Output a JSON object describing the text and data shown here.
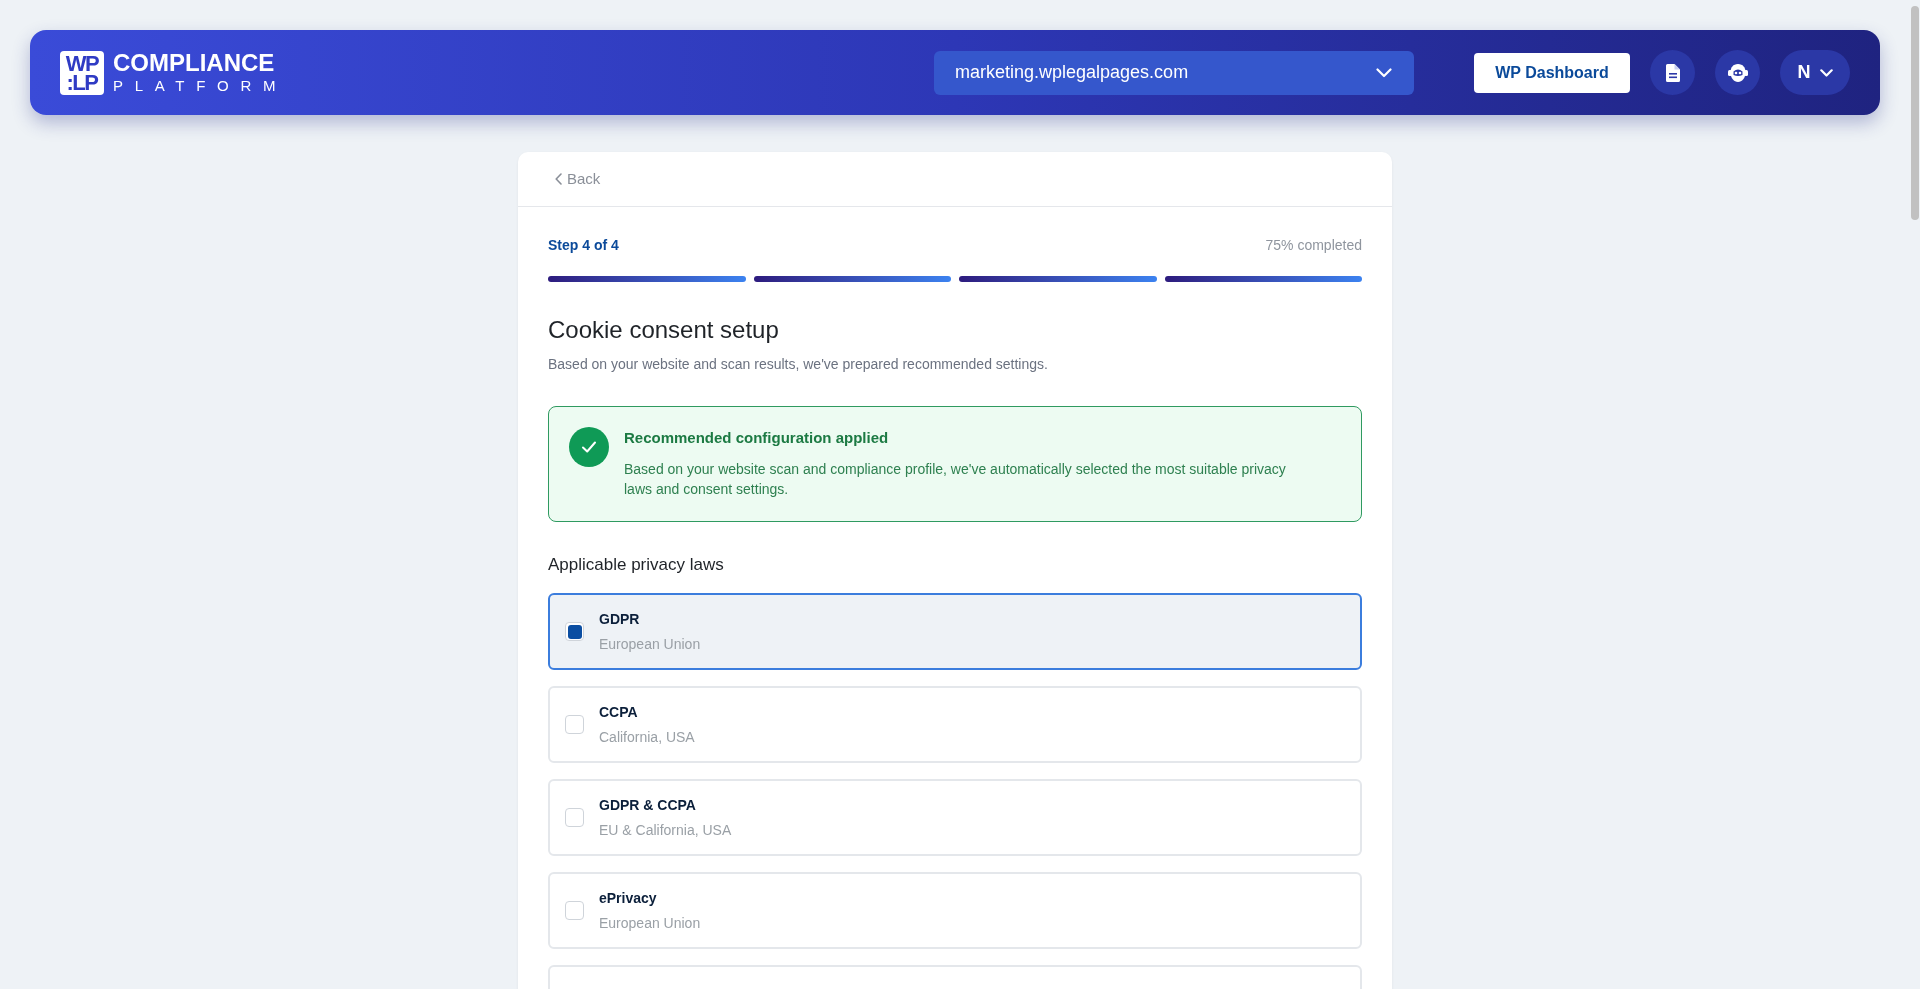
{
  "header": {
    "logo_mark": [
      "WP",
      ":LP"
    ],
    "brand": "COMPLIANCE",
    "brand_sub": "PLATFORM",
    "site_select": {
      "value": "marketing.wplegalpages.com"
    },
    "dashboard_button": "WP Dashboard",
    "user_menu": {
      "initial": "N"
    }
  },
  "card": {
    "back": "Back",
    "step": "Step 4 of 4",
    "progress_text": "75% completed",
    "progress_segments": [
      {
        "filled": true
      },
      {
        "filled": true
      },
      {
        "filled": true
      },
      {
        "filled": true
      }
    ],
    "title": "Cookie consent setup",
    "subtitle": "Based on your website and scan results, we've prepared recommended settings.",
    "notice": {
      "title": "Recommended configuration applied",
      "text": "Based on your website scan and compliance profile, we've automatically selected the most suitable privacy laws and consent settings."
    },
    "laws_heading": "Applicable privacy laws",
    "laws": [
      {
        "name": "GDPR",
        "region": "European Union",
        "checked": true
      },
      {
        "name": "CCPA",
        "region": "California, USA",
        "checked": false
      },
      {
        "name": "GDPR & CCPA",
        "region": "EU & California, USA",
        "checked": false
      },
      {
        "name": "ePrivacy",
        "region": "European Union",
        "checked": false
      }
    ],
    "laws_overflow": true
  }
}
